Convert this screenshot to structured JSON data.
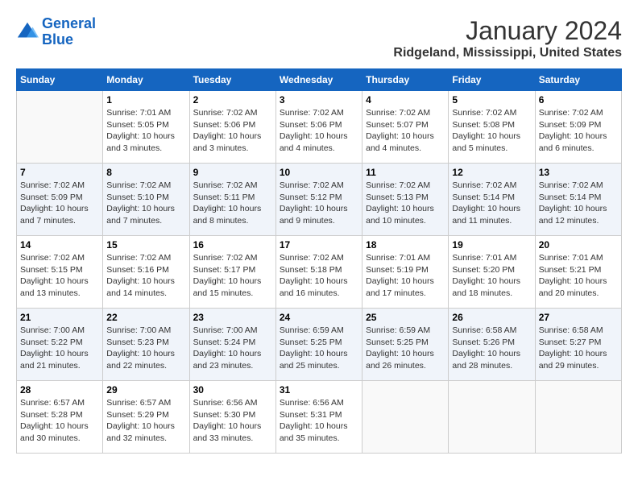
{
  "logo": {
    "line1": "General",
    "line2": "Blue"
  },
  "title": "January 2024",
  "subtitle": "Ridgeland, Mississippi, United States",
  "weekdays": [
    "Sunday",
    "Monday",
    "Tuesday",
    "Wednesday",
    "Thursday",
    "Friday",
    "Saturday"
  ],
  "weeks": [
    [
      {
        "day": "",
        "sunrise": "",
        "sunset": "",
        "daylight": ""
      },
      {
        "day": "1",
        "sunrise": "Sunrise: 7:01 AM",
        "sunset": "Sunset: 5:05 PM",
        "daylight": "Daylight: 10 hours and 3 minutes."
      },
      {
        "day": "2",
        "sunrise": "Sunrise: 7:02 AM",
        "sunset": "Sunset: 5:06 PM",
        "daylight": "Daylight: 10 hours and 3 minutes."
      },
      {
        "day": "3",
        "sunrise": "Sunrise: 7:02 AM",
        "sunset": "Sunset: 5:06 PM",
        "daylight": "Daylight: 10 hours and 4 minutes."
      },
      {
        "day": "4",
        "sunrise": "Sunrise: 7:02 AM",
        "sunset": "Sunset: 5:07 PM",
        "daylight": "Daylight: 10 hours and 4 minutes."
      },
      {
        "day": "5",
        "sunrise": "Sunrise: 7:02 AM",
        "sunset": "Sunset: 5:08 PM",
        "daylight": "Daylight: 10 hours and 5 minutes."
      },
      {
        "day": "6",
        "sunrise": "Sunrise: 7:02 AM",
        "sunset": "Sunset: 5:09 PM",
        "daylight": "Daylight: 10 hours and 6 minutes."
      }
    ],
    [
      {
        "day": "7",
        "sunrise": "Sunrise: 7:02 AM",
        "sunset": "Sunset: 5:09 PM",
        "daylight": "Daylight: 10 hours and 7 minutes."
      },
      {
        "day": "8",
        "sunrise": "Sunrise: 7:02 AM",
        "sunset": "Sunset: 5:10 PM",
        "daylight": "Daylight: 10 hours and 7 minutes."
      },
      {
        "day": "9",
        "sunrise": "Sunrise: 7:02 AM",
        "sunset": "Sunset: 5:11 PM",
        "daylight": "Daylight: 10 hours and 8 minutes."
      },
      {
        "day": "10",
        "sunrise": "Sunrise: 7:02 AM",
        "sunset": "Sunset: 5:12 PM",
        "daylight": "Daylight: 10 hours and 9 minutes."
      },
      {
        "day": "11",
        "sunrise": "Sunrise: 7:02 AM",
        "sunset": "Sunset: 5:13 PM",
        "daylight": "Daylight: 10 hours and 10 minutes."
      },
      {
        "day": "12",
        "sunrise": "Sunrise: 7:02 AM",
        "sunset": "Sunset: 5:14 PM",
        "daylight": "Daylight: 10 hours and 11 minutes."
      },
      {
        "day": "13",
        "sunrise": "Sunrise: 7:02 AM",
        "sunset": "Sunset: 5:14 PM",
        "daylight": "Daylight: 10 hours and 12 minutes."
      }
    ],
    [
      {
        "day": "14",
        "sunrise": "Sunrise: 7:02 AM",
        "sunset": "Sunset: 5:15 PM",
        "daylight": "Daylight: 10 hours and 13 minutes."
      },
      {
        "day": "15",
        "sunrise": "Sunrise: 7:02 AM",
        "sunset": "Sunset: 5:16 PM",
        "daylight": "Daylight: 10 hours and 14 minutes."
      },
      {
        "day": "16",
        "sunrise": "Sunrise: 7:02 AM",
        "sunset": "Sunset: 5:17 PM",
        "daylight": "Daylight: 10 hours and 15 minutes."
      },
      {
        "day": "17",
        "sunrise": "Sunrise: 7:02 AM",
        "sunset": "Sunset: 5:18 PM",
        "daylight": "Daylight: 10 hours and 16 minutes."
      },
      {
        "day": "18",
        "sunrise": "Sunrise: 7:01 AM",
        "sunset": "Sunset: 5:19 PM",
        "daylight": "Daylight: 10 hours and 17 minutes."
      },
      {
        "day": "19",
        "sunrise": "Sunrise: 7:01 AM",
        "sunset": "Sunset: 5:20 PM",
        "daylight": "Daylight: 10 hours and 18 minutes."
      },
      {
        "day": "20",
        "sunrise": "Sunrise: 7:01 AM",
        "sunset": "Sunset: 5:21 PM",
        "daylight": "Daylight: 10 hours and 20 minutes."
      }
    ],
    [
      {
        "day": "21",
        "sunrise": "Sunrise: 7:00 AM",
        "sunset": "Sunset: 5:22 PM",
        "daylight": "Daylight: 10 hours and 21 minutes."
      },
      {
        "day": "22",
        "sunrise": "Sunrise: 7:00 AM",
        "sunset": "Sunset: 5:23 PM",
        "daylight": "Daylight: 10 hours and 22 minutes."
      },
      {
        "day": "23",
        "sunrise": "Sunrise: 7:00 AM",
        "sunset": "Sunset: 5:24 PM",
        "daylight": "Daylight: 10 hours and 23 minutes."
      },
      {
        "day": "24",
        "sunrise": "Sunrise: 6:59 AM",
        "sunset": "Sunset: 5:25 PM",
        "daylight": "Daylight: 10 hours and 25 minutes."
      },
      {
        "day": "25",
        "sunrise": "Sunrise: 6:59 AM",
        "sunset": "Sunset: 5:25 PM",
        "daylight": "Daylight: 10 hours and 26 minutes."
      },
      {
        "day": "26",
        "sunrise": "Sunrise: 6:58 AM",
        "sunset": "Sunset: 5:26 PM",
        "daylight": "Daylight: 10 hours and 28 minutes."
      },
      {
        "day": "27",
        "sunrise": "Sunrise: 6:58 AM",
        "sunset": "Sunset: 5:27 PM",
        "daylight": "Daylight: 10 hours and 29 minutes."
      }
    ],
    [
      {
        "day": "28",
        "sunrise": "Sunrise: 6:57 AM",
        "sunset": "Sunset: 5:28 PM",
        "daylight": "Daylight: 10 hours and 30 minutes."
      },
      {
        "day": "29",
        "sunrise": "Sunrise: 6:57 AM",
        "sunset": "Sunset: 5:29 PM",
        "daylight": "Daylight: 10 hours and 32 minutes."
      },
      {
        "day": "30",
        "sunrise": "Sunrise: 6:56 AM",
        "sunset": "Sunset: 5:30 PM",
        "daylight": "Daylight: 10 hours and 33 minutes."
      },
      {
        "day": "31",
        "sunrise": "Sunrise: 6:56 AM",
        "sunset": "Sunset: 5:31 PM",
        "daylight": "Daylight: 10 hours and 35 minutes."
      },
      {
        "day": "",
        "sunrise": "",
        "sunset": "",
        "daylight": ""
      },
      {
        "day": "",
        "sunrise": "",
        "sunset": "",
        "daylight": ""
      },
      {
        "day": "",
        "sunrise": "",
        "sunset": "",
        "daylight": ""
      }
    ]
  ]
}
